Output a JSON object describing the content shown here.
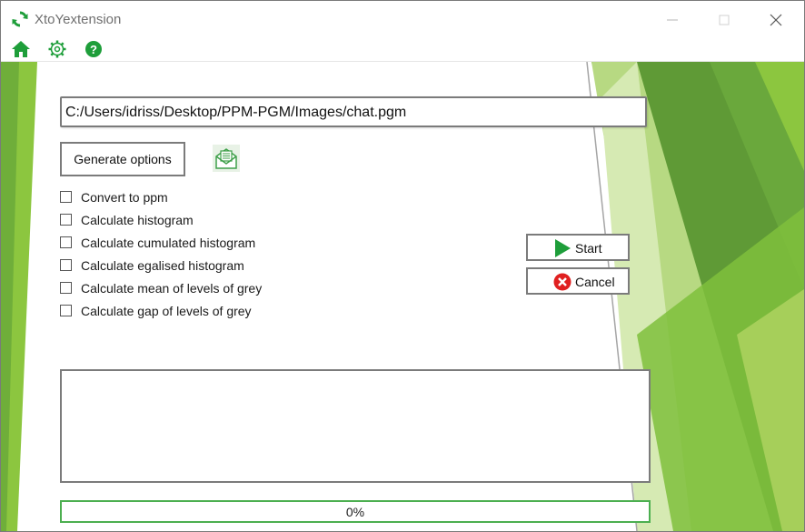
{
  "window": {
    "title": "XtoYextension",
    "controls": [
      "minimize",
      "maximize",
      "close"
    ]
  },
  "toolbar": {
    "icons": [
      "home-icon",
      "gear-icon",
      "help-icon"
    ]
  },
  "file": {
    "path": "C:/Users/idriss/Desktop/PPM-PGM/Images/chat.pgm"
  },
  "generate_button": {
    "label": "Generate options"
  },
  "options": [
    {
      "label": "Convert to ppm",
      "checked": false
    },
    {
      "label": "Calculate histogram",
      "checked": false
    },
    {
      "label": "Calculate cumulated histogram",
      "checked": false
    },
    {
      "label": "Calculate egalised histogram",
      "checked": false
    },
    {
      "label": "Calculate mean of levels of grey",
      "checked": false
    },
    {
      "label": "Calculate gap of levels of grey",
      "checked": false
    }
  ],
  "actions": {
    "start_label": "Start",
    "cancel_label": "Cancel"
  },
  "log": {
    "text": ""
  },
  "progress": {
    "value": 0,
    "label": "0%"
  },
  "colors": {
    "accent": "#1e9e3a",
    "progress_border": "#4caf50",
    "bg_green_dark": "#5f9a36",
    "bg_green_mid": "#8cc63f",
    "bg_green_light": "#c8e29c",
    "cancel_red": "#e02020"
  }
}
